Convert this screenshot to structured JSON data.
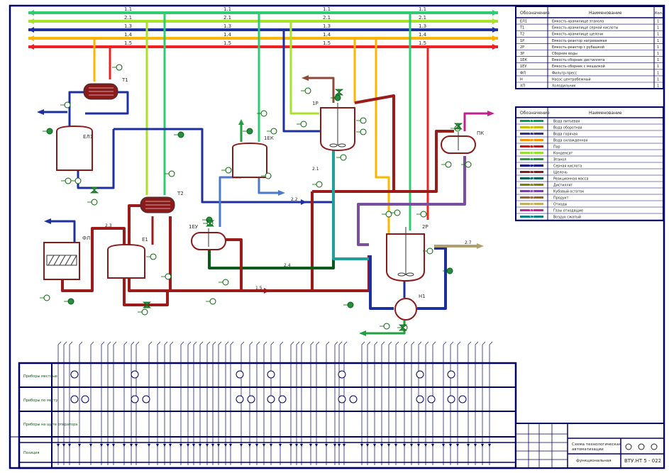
{
  "legend_top": {
    "header": {
      "symbol": "Обозначение",
      "name": "Наименование",
      "qty": "Кол."
    },
    "rows": [
      {
        "symbol": "ЕЛ1",
        "name": "Емкость-хранилище этанола",
        "qty": "1"
      },
      {
        "symbol": "Т1",
        "name": "Емкость-хранилище серной кислоты",
        "qty": "1"
      },
      {
        "symbol": "Т2",
        "name": "Емкость-хранилище щелочи",
        "qty": "1"
      },
      {
        "symbol": "1Р",
        "name": "Емкость-реактор нагреваемая",
        "qty": "1"
      },
      {
        "symbol": "2Р",
        "name": "Емкость-реактор с рубашкой",
        "qty": "1"
      },
      {
        "symbol": "3Р",
        "name": "Сборник воды",
        "qty": "1"
      },
      {
        "symbol": "1ЕК",
        "name": "Емкость-сборник дистиллята",
        "qty": "1"
      },
      {
        "symbol": "1ЕУ",
        "name": "Емкость-сборник с мешалкой",
        "qty": "1"
      },
      {
        "symbol": "ФЛ",
        "name": "Фильтр-пресс",
        "qty": "1"
      },
      {
        "symbol": "Н",
        "name": "Насос центробежный",
        "qty": "1"
      },
      {
        "symbol": "ХП",
        "name": "Холодильник",
        "qty": "1"
      }
    ]
  },
  "legend_lines": {
    "header": {
      "symbol": "Обозначение",
      "name": "Наименование"
    },
    "rows": [
      {
        "symbol": "1.1",
        "name": "Вода питьевая",
        "color": "#00a060"
      },
      {
        "symbol": "1.2",
        "name": "Вода оборотная",
        "color": "#c0c000"
      },
      {
        "symbol": "1.3",
        "name": "Вода горячая",
        "color": "#303090"
      },
      {
        "symbol": "1.4",
        "name": "Вода охлажденная",
        "color": "#ff9000"
      },
      {
        "symbol": "1.5",
        "name": "Пар",
        "color": "#e00000"
      },
      {
        "symbol": "1.6",
        "name": "Конденсат",
        "color": "#98e030"
      },
      {
        "symbol": "2.1",
        "name": "Этанол",
        "color": "#20a040"
      },
      {
        "symbol": "2.2",
        "name": "Серная кислота",
        "color": "#000080"
      },
      {
        "symbol": "2.3",
        "name": "Щелочь",
        "color": "#8b1a1a"
      },
      {
        "symbol": "2.4",
        "name": "Реакционная масса",
        "color": "#006060"
      },
      {
        "symbol": "2.5",
        "name": "Дистиллят",
        "color": "#808000"
      },
      {
        "symbol": "2.6",
        "name": "Кубовый остаток",
        "color": "#7b3fa0"
      },
      {
        "symbol": "2.7",
        "name": "Продукт",
        "color": "#a06020"
      },
      {
        "symbol": "2.8",
        "name": "Отходы",
        "color": "#c0b060"
      },
      {
        "symbol": "3.1",
        "name": "Газы отходящие",
        "color": "#d020a0"
      },
      {
        "symbol": "3.2",
        "name": "Воздух сжатый",
        "color": "#008080"
      }
    ]
  },
  "top_lines": [
    {
      "code": "1.1",
      "color": "#2ecc71"
    },
    {
      "code": "2.1",
      "color": "#a8e22a"
    },
    {
      "code": "1.3",
      "color": "#1e2f9e"
    },
    {
      "code": "1.4",
      "color": "#ffb400"
    },
    {
      "code": "1.5",
      "color": "#ee2222"
    }
  ],
  "equipment": {
    "el1": "ЕЛ1",
    "t1": "Т1",
    "t2": "Т2",
    "ek": "1ЕК",
    "r1": "1Р",
    "r2": "2Р",
    "pk": "ПК",
    "eu": "1ЕУ",
    "fl": "ФЛ",
    "tank_b": "Е1",
    "pump": "Н1"
  },
  "flow_labels": {
    "f1": "2.1",
    "f2": "2.3",
    "f3": "1.5",
    "f4": "2.2",
    "f5": "2.4",
    "f6": "2.7"
  },
  "table_rows": {
    "row1": "Приборы местные",
    "row2": "Приборы по месту",
    "row3": "Приборы на щите оператора",
    "row4": "Позиция"
  },
  "title_block": {
    "line1": "Схема технологическая",
    "line2": "автоматизации",
    "line3": "функциональная",
    "doc_code": "ВТУ.НТ 5 - 022"
  },
  "colors": {
    "frame": "#000066",
    "vessel": "#8b1a1a",
    "instrument": "#006600",
    "drain": "#2a8a6a"
  }
}
